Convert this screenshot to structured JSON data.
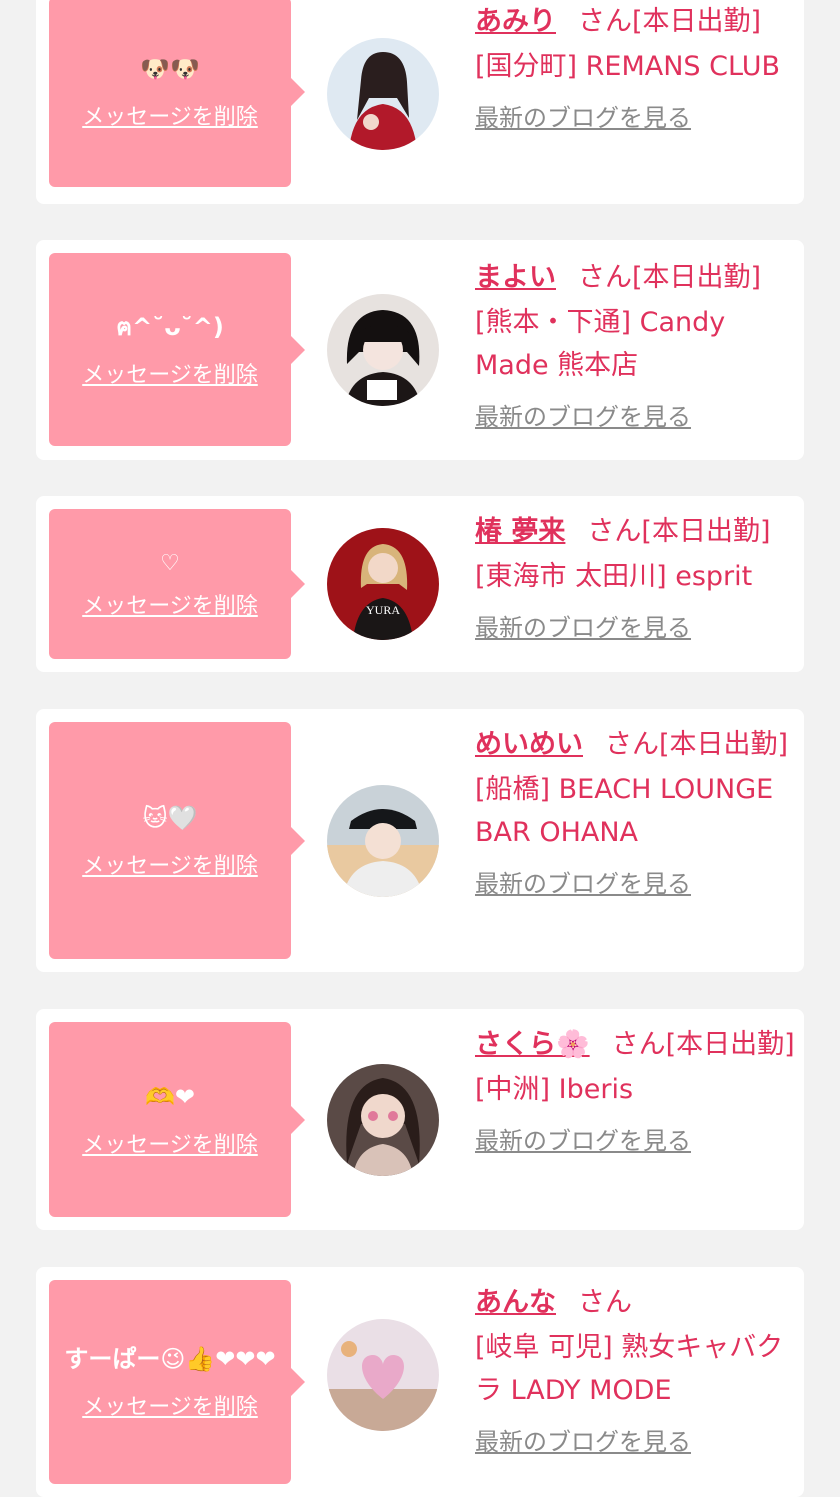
{
  "delete_label": "メッセージを削除",
  "blog_label": "最新のブログを見る",
  "entries": [
    {
      "message": "🐶🐶",
      "name": "あみり",
      "suffix": "さん",
      "status": "[本日出勤]",
      "shop": "[国分町] REMANS CLUB"
    },
    {
      "message": "ฅ^˘ᴗ˘^)",
      "name": "まよい",
      "suffix": "さん",
      "status": "[本日出勤]",
      "shop": "[熊本・下通] Candy Made 熊本店"
    },
    {
      "message": "♡",
      "name": "椿 夢来",
      "suffix": "さん",
      "status": "[本日出勤]",
      "shop": "[東海市 太田川] esprit"
    },
    {
      "message": "🐱🤍",
      "name": "めいめい",
      "suffix": "さん",
      "status": "[本日出勤]",
      "shop": "[船橋] BEACH LOUNGE BAR OHANA"
    },
    {
      "message": "🫶❤",
      "name": "さくら🌸",
      "suffix": "さん",
      "status": "[本日出勤]",
      "shop": "[中洲] Iberis"
    },
    {
      "message": "すーぱー😉👍❤❤❤",
      "name": "あんな",
      "suffix": "さん",
      "status": "",
      "shop": "[岐阜 可児] 熟女キャバクラ LADY MODE"
    }
  ],
  "colors": {
    "accent": "#e0315c",
    "bubble": "#ff9aa9",
    "page_bg": "#f2f2f2",
    "link_gray": "#8a8a8a"
  }
}
